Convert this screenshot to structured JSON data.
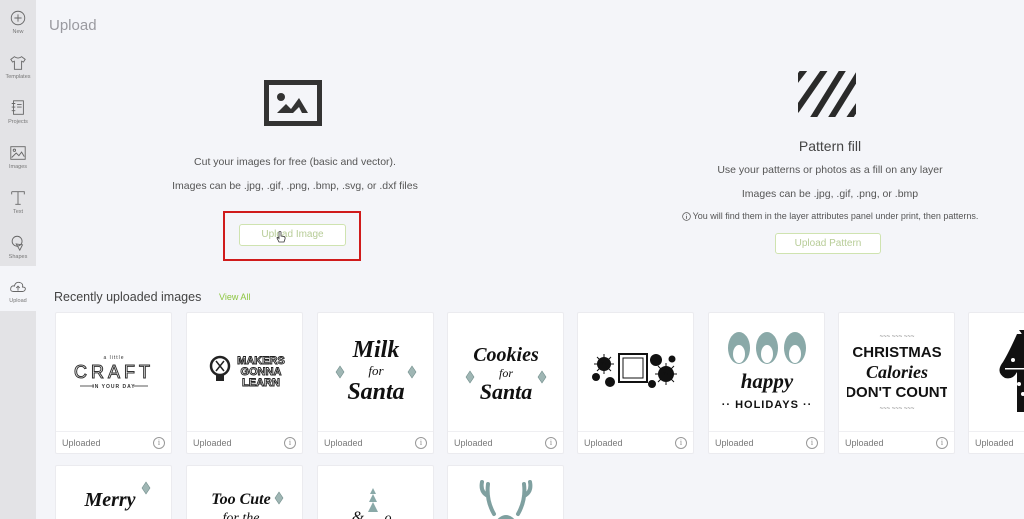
{
  "sidebar": {
    "items": [
      {
        "label": "New",
        "icon": "plus-circle-icon"
      },
      {
        "label": "Templates",
        "icon": "tshirt-icon"
      },
      {
        "label": "Projects",
        "icon": "notebook-icon"
      },
      {
        "label": "Images",
        "icon": "image-icon"
      },
      {
        "label": "Text",
        "icon": "text-t-icon"
      },
      {
        "label": "Shapes",
        "icon": "shapes-icon"
      },
      {
        "label": "Upload",
        "icon": "cloud-upload-icon",
        "active": true
      }
    ]
  },
  "header": {
    "title": "Upload"
  },
  "upload_image": {
    "icon": "image-icon",
    "line1": "Cut your images for free (basic and vector).",
    "line2": "Images can be .jpg, .gif, .png, .bmp, .svg, or .dxf files",
    "button": "Upload Image"
  },
  "pattern_fill": {
    "icon": "stripes-pattern-icon",
    "title": "Pattern fill",
    "line1": "Use your patterns or photos as a fill on any layer",
    "line2": "Images can be .jpg, .gif, .png, or .bmp",
    "note": "You will find them in the layer attributes panel under print, then patterns.",
    "note_icon": "info-icon",
    "button": "Upload Pattern"
  },
  "recent": {
    "title": "Recently uploaded images",
    "view_all": "View All",
    "images": [
      {
        "name": "A Little Craft In Your Day",
        "status": "Uploaded"
      },
      {
        "name": "Makers Gonna Learn",
        "status": "Uploaded"
      },
      {
        "name": "Milk for Santa",
        "status": "Uploaded"
      },
      {
        "name": "Cookies for Santa",
        "status": "Uploaded"
      },
      {
        "name": "Snowflake Frame",
        "status": "Uploaded"
      },
      {
        "name": "Happy Holidays Penguins",
        "status": "Uploaded"
      },
      {
        "name": "Christmas Calories Don't Count",
        "status": "Uploaded"
      },
      {
        "name": "Mitten",
        "status": "Uploaded"
      },
      {
        "name": "Merry Christmas",
        "status": ""
      },
      {
        "name": "Too Cute for the Naughty List",
        "status": ""
      },
      {
        "name": "Trees Script",
        "status": ""
      },
      {
        "name": "Reindeer Antlers",
        "status": ""
      }
    ]
  },
  "colors": {
    "accent_green": "#8cc63f",
    "highlight_red": "#d01b1b",
    "holly_teal": "#7fa0a0"
  }
}
